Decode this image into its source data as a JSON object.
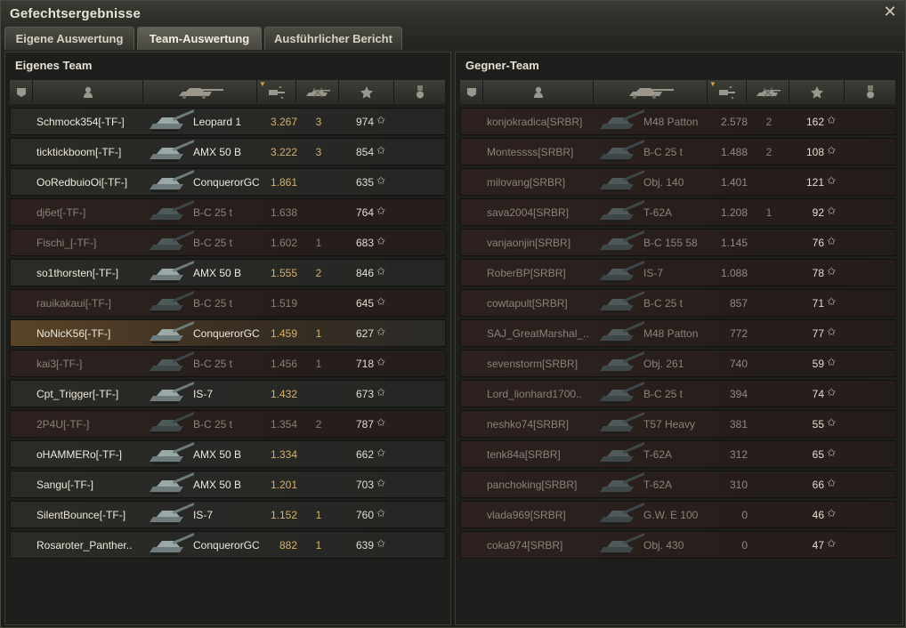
{
  "window": {
    "title": "Gefechtsergebnisse",
    "close_icon": "close-icon"
  },
  "tabs": [
    {
      "label": "Eigene Auswertung",
      "active": false
    },
    {
      "label": "Team-Auswertung",
      "active": true
    },
    {
      "label": "Ausführlicher Bericht",
      "active": false
    }
  ],
  "colors": {
    "accent": "#d7b26a",
    "dead_row": "#2c211e",
    "player_row": "#5a4428"
  },
  "own_team": {
    "title": "Eigenes Team",
    "header_icons": [
      "squad-icon",
      "player-icon",
      "tank-icon",
      "damage-icon",
      "kills-icon",
      "xp-star-icon",
      "medal-icon"
    ],
    "sorted_column": "damage",
    "players": [
      {
        "name": "Schmock354[-TF-]",
        "vehicle": "Leopard 1",
        "damage": "3.267",
        "kills": "3",
        "xp": "974",
        "dead": false,
        "player": false
      },
      {
        "name": "ticktickboom[-TF-]",
        "vehicle": "AMX 50 B",
        "damage": "3.222",
        "kills": "3",
        "xp": "854",
        "dead": false,
        "player": false
      },
      {
        "name": "OoRedbuioOi[-TF-]",
        "vehicle": "ConquerorGC",
        "damage": "1.861",
        "kills": "",
        "xp": "635",
        "dead": false,
        "player": false
      },
      {
        "name": "dj6et[-TF-]",
        "vehicle": "B-C 25 t",
        "damage": "1.638",
        "kills": "",
        "xp": "764",
        "dead": true,
        "player": false
      },
      {
        "name": "Fischi_[-TF-]",
        "vehicle": "B-C 25 t",
        "damage": "1.602",
        "kills": "1",
        "xp": "683",
        "dead": true,
        "player": false
      },
      {
        "name": "so1thorsten[-TF-]",
        "vehicle": "AMX 50 B",
        "damage": "1.555",
        "kills": "2",
        "xp": "846",
        "dead": false,
        "player": false
      },
      {
        "name": "rauikakaui[-TF-]",
        "vehicle": "B-C 25 t",
        "damage": "1.519",
        "kills": "",
        "xp": "645",
        "dead": true,
        "player": false
      },
      {
        "name": "NoNicK56[-TF-]",
        "vehicle": "ConquerorGC",
        "damage": "1.459",
        "kills": "1",
        "xp": "627",
        "dead": false,
        "player": true
      },
      {
        "name": "kai3[-TF-]",
        "vehicle": "B-C 25 t",
        "damage": "1.456",
        "kills": "1",
        "xp": "718",
        "dead": true,
        "player": false
      },
      {
        "name": "Cpt_Trigger[-TF-]",
        "vehicle": "IS-7",
        "damage": "1.432",
        "kills": "",
        "xp": "673",
        "dead": false,
        "player": false
      },
      {
        "name": "2P4U[-TF-]",
        "vehicle": "B-C 25 t",
        "damage": "1.354",
        "kills": "2",
        "xp": "787",
        "dead": true,
        "player": false
      },
      {
        "name": "oHAMMERo[-TF-]",
        "vehicle": "AMX 50 B",
        "damage": "1.334",
        "kills": "",
        "xp": "662",
        "dead": false,
        "player": false
      },
      {
        "name": "Sangu[-TF-]",
        "vehicle": "AMX 50 B",
        "damage": "1.201",
        "kills": "",
        "xp": "703",
        "dead": false,
        "player": false
      },
      {
        "name": "SilentBounce[-TF-]",
        "vehicle": "IS-7",
        "damage": "1.152",
        "kills": "1",
        "xp": "760",
        "dead": false,
        "player": false
      },
      {
        "name": "Rosaroter_Panther..",
        "vehicle": "ConquerorGC",
        "damage": "882",
        "kills": "1",
        "xp": "639",
        "dead": false,
        "player": false
      }
    ]
  },
  "enemy_team": {
    "title": "Gegner-Team",
    "header_icons": [
      "squad-icon",
      "player-icon",
      "tank-icon",
      "damage-icon",
      "kills-icon",
      "xp-star-icon",
      "medal-icon"
    ],
    "sorted_column": "damage",
    "players": [
      {
        "name": "konjokradica[SRBR]",
        "vehicle": "M48 Patton",
        "damage": "2.578",
        "kills": "2",
        "xp": "162",
        "dead": true,
        "player": false
      },
      {
        "name": "Montessss[SRBR]",
        "vehicle": "B-C 25 t",
        "damage": "1.488",
        "kills": "2",
        "xp": "108",
        "dead": true,
        "player": false
      },
      {
        "name": "milovang[SRBR]",
        "vehicle": "Obj. 140",
        "damage": "1.401",
        "kills": "",
        "xp": "121",
        "dead": true,
        "player": false
      },
      {
        "name": "sava2004[SRBR]",
        "vehicle": "T-62A",
        "damage": "1.208",
        "kills": "1",
        "xp": "92",
        "dead": true,
        "player": false
      },
      {
        "name": "vanjaonjin[SRBR]",
        "vehicle": "B-C 155 58",
        "damage": "1.145",
        "kills": "",
        "xp": "76",
        "dead": true,
        "player": false
      },
      {
        "name": "RoberBP[SRBR]",
        "vehicle": "IS-7",
        "damage": "1.088",
        "kills": "",
        "xp": "78",
        "dead": true,
        "player": false
      },
      {
        "name": "cowtapult[SRBR]",
        "vehicle": "B-C 25 t",
        "damage": "857",
        "kills": "",
        "xp": "71",
        "dead": true,
        "player": false
      },
      {
        "name": "SAJ_GreatMarshal_..",
        "vehicle": "M48 Patton",
        "damage": "772",
        "kills": "",
        "xp": "77",
        "dead": true,
        "player": false
      },
      {
        "name": "sevenstorm[SRBR]",
        "vehicle": "Obj. 261",
        "damage": "740",
        "kills": "",
        "xp": "59",
        "dead": true,
        "player": false
      },
      {
        "name": "Lord_lionhard1700..",
        "vehicle": "B-C 25 t",
        "damage": "394",
        "kills": "",
        "xp": "74",
        "dead": true,
        "player": false
      },
      {
        "name": "neshko74[SRBR]",
        "vehicle": "T57 Heavy",
        "damage": "381",
        "kills": "",
        "xp": "55",
        "dead": true,
        "player": false
      },
      {
        "name": "tenk84a[SRBR]",
        "vehicle": "T-62A",
        "damage": "312",
        "kills": "",
        "xp": "65",
        "dead": true,
        "player": false
      },
      {
        "name": "panchoking[SRBR]",
        "vehicle": "T-62A",
        "damage": "310",
        "kills": "",
        "xp": "66",
        "dead": true,
        "player": false
      },
      {
        "name": "vlada969[SRBR]",
        "vehicle": "G.W. E 100",
        "damage": "0",
        "kills": "",
        "xp": "46",
        "dead": true,
        "player": false
      },
      {
        "name": "coka974[SRBR]",
        "vehicle": "Obj. 430",
        "damage": "0",
        "kills": "",
        "xp": "47",
        "dead": true,
        "player": false
      }
    ]
  }
}
